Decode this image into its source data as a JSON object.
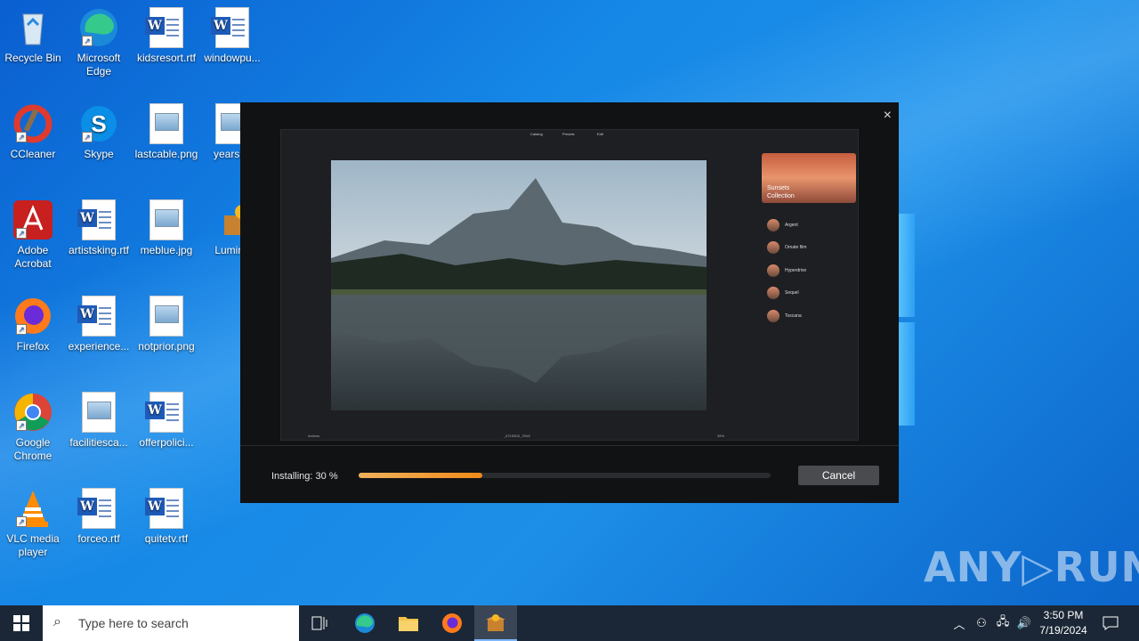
{
  "desktop": {
    "icons": [
      {
        "label": "Recycle Bin"
      },
      {
        "label": "Microsoft Edge"
      },
      {
        "label": "kidsresort.rtf"
      },
      {
        "label": "windowpu..."
      },
      {
        "label": "CCleaner"
      },
      {
        "label": "Skype"
      },
      {
        "label": "lastcable.png"
      },
      {
        "label": "yearskb"
      },
      {
        "label": "Adobe Acrobat"
      },
      {
        "label": "artistsking.rtf"
      },
      {
        "label": "meblue.jpg"
      },
      {
        "label": "Lumina"
      },
      {
        "label": "Firefox"
      },
      {
        "label": "experience..."
      },
      {
        "label": "notprior.png"
      },
      {
        "label": "Google Chrome"
      },
      {
        "label": "facilitiesca..."
      },
      {
        "label": "offerpolici..."
      },
      {
        "label": "VLC media player"
      },
      {
        "label": "forceo.rtf"
      },
      {
        "label": "quitetv.rtf"
      }
    ]
  },
  "installer": {
    "close": "×",
    "preview": {
      "tabs": [
        "Catalog",
        "Presets",
        "Edit"
      ],
      "card_title": "Sunsets",
      "card_subtitle": "Collection",
      "presets": [
        "Argent",
        "Ornate film",
        "Hyperdrive",
        "Sequel",
        "Toscana"
      ],
      "bottom_left": "Actions",
      "bottom_center": "_6715303_.RW2",
      "bottom_right": "39%"
    },
    "status_text": "Installing: 30 %",
    "progress": 0.3,
    "cancel_label": "Cancel"
  },
  "watermark": "ANY▷RUN",
  "taskbar": {
    "search_placeholder": "Type here to search",
    "time": "3:50 PM",
    "date": "7/19/2024"
  },
  "colors": {
    "progress": "#f08a1a",
    "taskbar": "#1b2736"
  }
}
